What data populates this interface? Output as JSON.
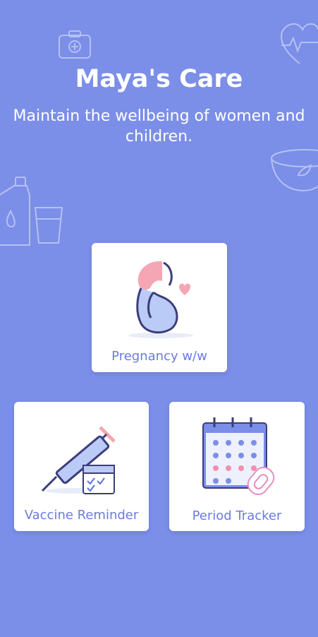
{
  "header": {
    "title": "Maya's Care",
    "subtitle": "Maintain the wellbeing of women and children."
  },
  "cards": {
    "pregnancy": {
      "label": "Pregnancy w/w",
      "icon": "pregnancy-icon"
    },
    "vaccine": {
      "label": "Vaccine Reminder",
      "icon": "syringe-calendar-icon"
    },
    "period": {
      "label": "Period Tracker",
      "icon": "calendar-pad-icon"
    }
  },
  "colors": {
    "background": "#7b8ee8",
    "card": "#ffffff",
    "label": "#6a7be0",
    "accent_pink": "#f3a3c4",
    "accent_blue": "#a9bff5"
  }
}
